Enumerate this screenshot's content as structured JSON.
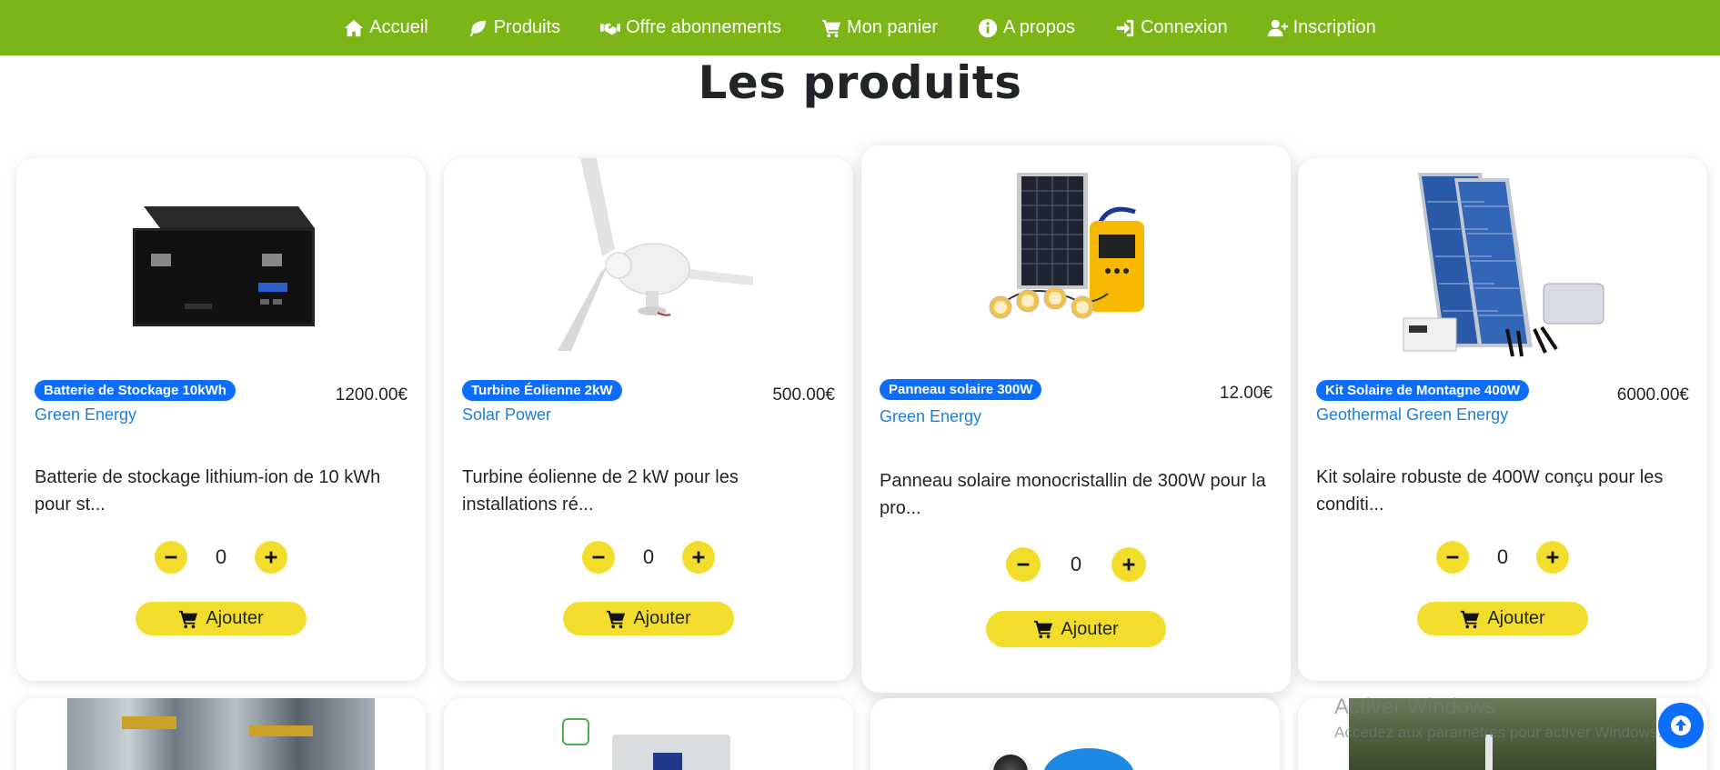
{
  "nav": {
    "items": [
      {
        "label": "Accueil",
        "icon": "home-icon"
      },
      {
        "label": "Produits",
        "icon": "leaf-icon"
      },
      {
        "label": "Offre abonnements",
        "icon": "handshake-icon"
      },
      {
        "label": "Mon panier",
        "icon": "cart-icon"
      },
      {
        "label": "A propos",
        "icon": "info-icon"
      },
      {
        "label": "Connexion",
        "icon": "sign-in-icon"
      },
      {
        "label": "Inscription",
        "icon": "user-plus-icon"
      }
    ]
  },
  "page": {
    "title": "Les produits"
  },
  "products": [
    {
      "name": "Batterie de Stockage 10kWh",
      "price": "1200.00€",
      "brand": "Green Energy",
      "description": "Batterie de stockage lithium-ion de 10 kWh pour st...",
      "quantity": "0",
      "add_label": "Ajouter",
      "image": "battery-image"
    },
    {
      "name": "Turbine Éolienne 2kW",
      "price": "500.00€",
      "brand": "Solar Power",
      "description": "Turbine éolienne de 2 kW pour les installations ré...",
      "quantity": "0",
      "add_label": "Ajouter",
      "image": "wind-turbine-image"
    },
    {
      "name": "Panneau solaire 300W",
      "price": "12.00€",
      "brand": "Green Energy",
      "description": "Panneau solaire monocristallin de 300W pour la pro...",
      "quantity": "0",
      "add_label": "Ajouter",
      "image": "solar-kit-image"
    },
    {
      "name": "Kit Solaire de Montagne 400W",
      "price": "6000.00€",
      "brand": "Geothermal Green Energy",
      "description": "Kit solaire robuste de 400W conçu pour les conditi...",
      "quantity": "0",
      "add_label": "Ajouter",
      "image": "solar-panels-image"
    }
  ],
  "watermark": {
    "line1": "Activer Windows",
    "line2": "Accédez aux paramètres pour activer Windows."
  },
  "colors": {
    "nav": "#7cb518",
    "badge": "#0d6efd",
    "button": "#f3dd2c",
    "brand": "#1d7ed8"
  }
}
